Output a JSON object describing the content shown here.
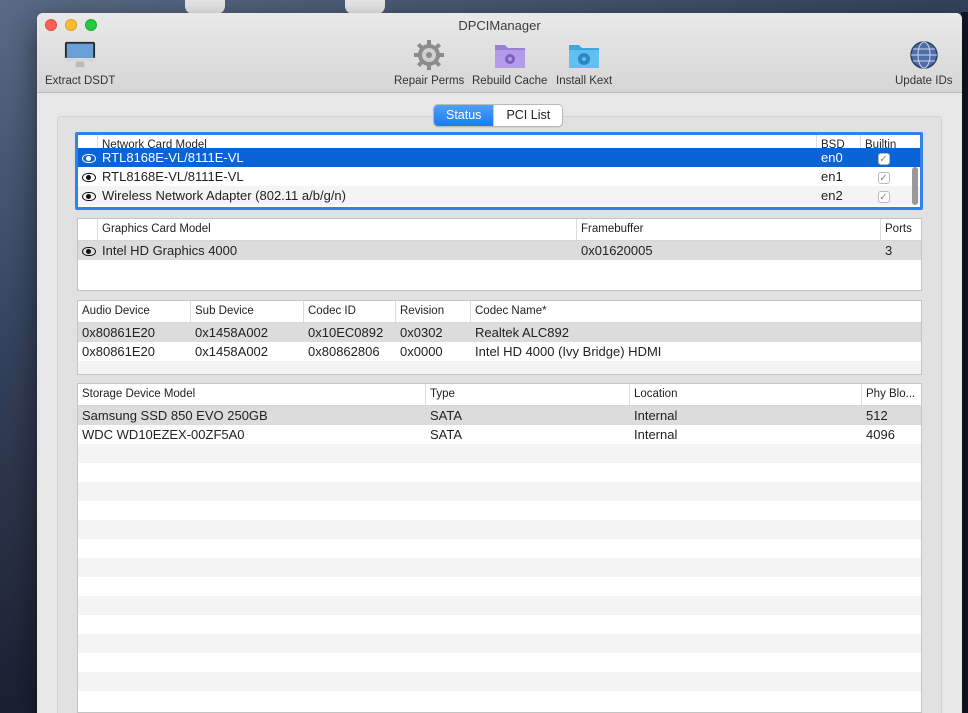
{
  "window": {
    "title": "DPCIManager"
  },
  "toolbar": {
    "extract_dsdt": "Extract DSDT",
    "repair_perms": "Repair Perms",
    "rebuild_cache": "Rebuild Cache",
    "install_kext": "Install Kext",
    "update_ids": "Update IDs"
  },
  "tabs": {
    "status": "Status",
    "pci_list": "PCI List"
  },
  "network": {
    "headers": [
      "Network Card Model",
      "BSD",
      "Builtin"
    ],
    "rows": [
      {
        "model": "RTL8168E-VL/8111E-VL",
        "bsd": "en0",
        "builtin": "✓"
      },
      {
        "model": "RTL8168E-VL/8111E-VL",
        "bsd": "en1",
        "builtin": "✓"
      },
      {
        "model": "Wireless Network Adapter (802.11 a/b/g/n)",
        "bsd": "en2",
        "builtin": "✓"
      }
    ]
  },
  "graphics": {
    "headers": [
      "Graphics Card Model",
      "Framebuffer",
      "Ports"
    ],
    "rows": [
      {
        "model": "Intel HD Graphics 4000",
        "framebuffer": "0x01620005",
        "ports": "3"
      }
    ]
  },
  "audio": {
    "headers": [
      "Audio Device",
      "Sub Device",
      "Codec ID",
      "Revision",
      "Codec Name*"
    ],
    "rows": [
      {
        "device": "0x80861E20",
        "sub": "0x1458A002",
        "codec": "0x10EC0892",
        "rev": "0x0302",
        "name": "Realtek ALC892"
      },
      {
        "device": "0x80861E20",
        "sub": "0x1458A002",
        "codec": "0x80862806",
        "rev": "0x0000",
        "name": "Intel HD 4000 (Ivy Bridge) HDMI"
      }
    ]
  },
  "storage": {
    "headers": [
      "Storage Device Model",
      "Type",
      "Location",
      "Phy Blo..."
    ],
    "rows": [
      {
        "model": "Samsung SSD 850 EVO 250GB",
        "type": "SATA",
        "location": "Internal",
        "phy": "512"
      },
      {
        "model": "WDC WD10EZEX-00ZF5A0",
        "type": "SATA",
        "location": "Internal",
        "phy": "4096"
      }
    ]
  },
  "colors": {
    "accent": "#1a7cf0",
    "selection": "#0b63d8"
  }
}
